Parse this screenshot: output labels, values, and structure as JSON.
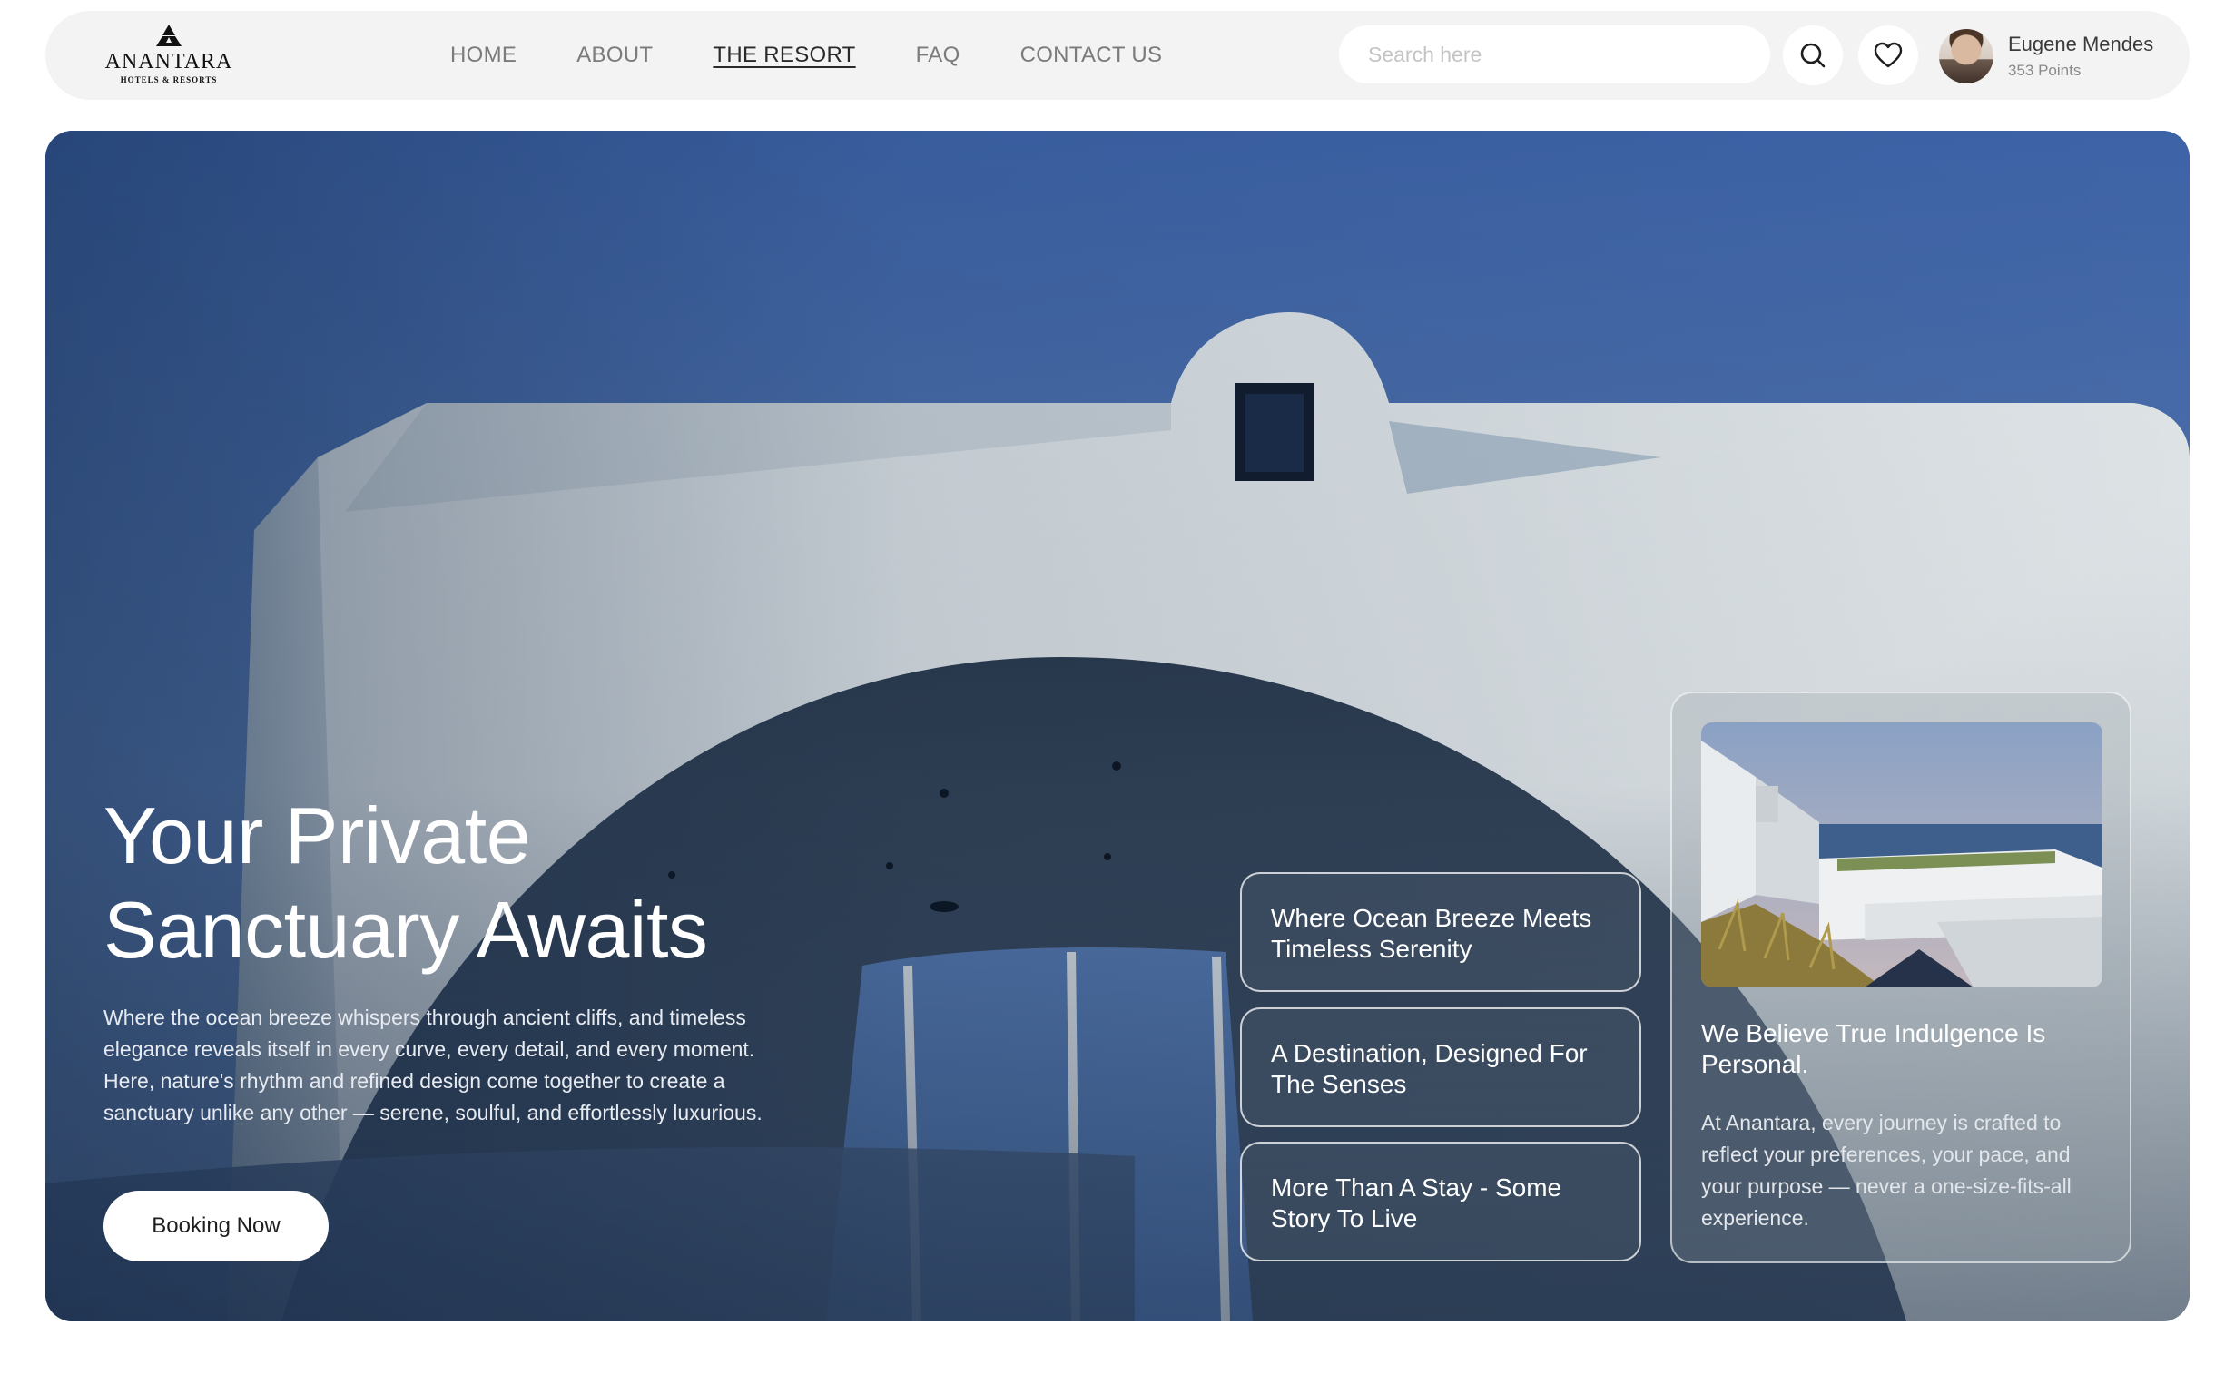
{
  "brand": {
    "name": "ANANTARA",
    "tagline": "HOTELS & RESORTS"
  },
  "nav": {
    "items": [
      {
        "label": "HOME",
        "active": false
      },
      {
        "label": "ABOUT",
        "active": false
      },
      {
        "label": "THE RESORT",
        "active": true
      },
      {
        "label": "FAQ",
        "active": false
      },
      {
        "label": "CONTACT US",
        "active": false
      }
    ]
  },
  "search": {
    "placeholder": "Search here",
    "value": ""
  },
  "icons": {
    "search": "search-icon",
    "favorites": "heart-icon"
  },
  "user": {
    "name": "Eugene Mendes",
    "points": "353 Points"
  },
  "hero": {
    "title_line1": "Your Private",
    "title_line2": "Sanctuary Awaits",
    "description": "Where the ocean breeze whispers through ancient cliffs, and timeless elegance reveals itself in every curve, every detail, and every moment. Here, nature's rhythm and refined design come together to create a sanctuary unlike any other — serene, soulful, and effortlessly luxurious.",
    "cta_label": "Booking Now"
  },
  "features": [
    {
      "label": "Where Ocean Breeze Meets Timeless Serenity"
    },
    {
      "label": "A Destination, Designed For The Senses"
    },
    {
      "label": "More Than A Stay -  Some Story To Live"
    }
  ],
  "info_panel": {
    "heading": "We Believe True Indulgence Is Personal.",
    "text": "At Anantara, every journey is crafted to reflect your preferences, your pace, and your purpose — never a one-size-fits-all experience."
  },
  "colors": {
    "nav_bg": "#f3f3f4",
    "sky": "#4b6eaa",
    "wall": "#dfe4e6",
    "text_light": "#ffffff"
  }
}
